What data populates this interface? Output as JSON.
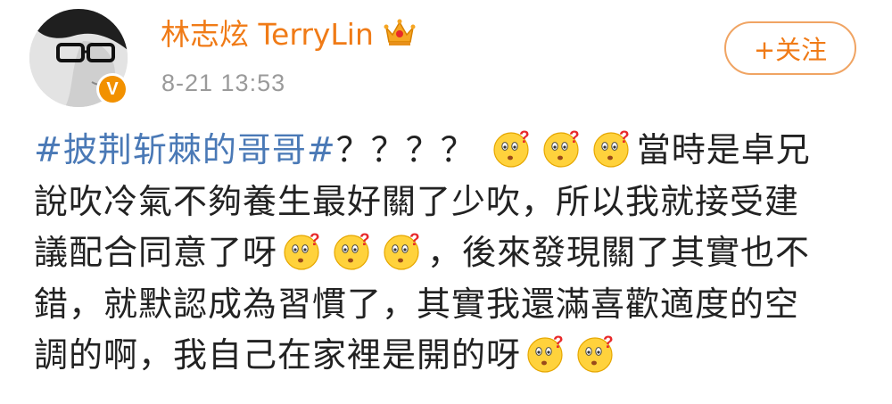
{
  "user": {
    "name": "林志炫 TerryLin",
    "timestamp": "8-21 13:53",
    "verified_badge": "V"
  },
  "actions": {
    "follow_label": "+关注"
  },
  "post": {
    "hashtag": "#披荆斩棘的哥哥#",
    "question_marks": "？？？？",
    "line1_text": "當時是卓兄",
    "line2": "說吹冷氣不夠養生最好關了少吹，所以我就接受建",
    "line3_text": "議配合同意了呀",
    "line3_after": "，後來發現關了其實也不",
    "line4": "錯，就默認成為習慣了，其實我還滿喜歡適度的空",
    "line5_text": "調的啊，我自己在家裡是開的呀"
  },
  "icons": {
    "emoji": "confused-face-emoji",
    "crown": "crown-icon",
    "badge": "verified-v-badge"
  },
  "colors": {
    "username": "#f07b17",
    "hashtag": "#4a79b6",
    "badge": "#f29100",
    "timestamp": "#9a9a9a"
  }
}
